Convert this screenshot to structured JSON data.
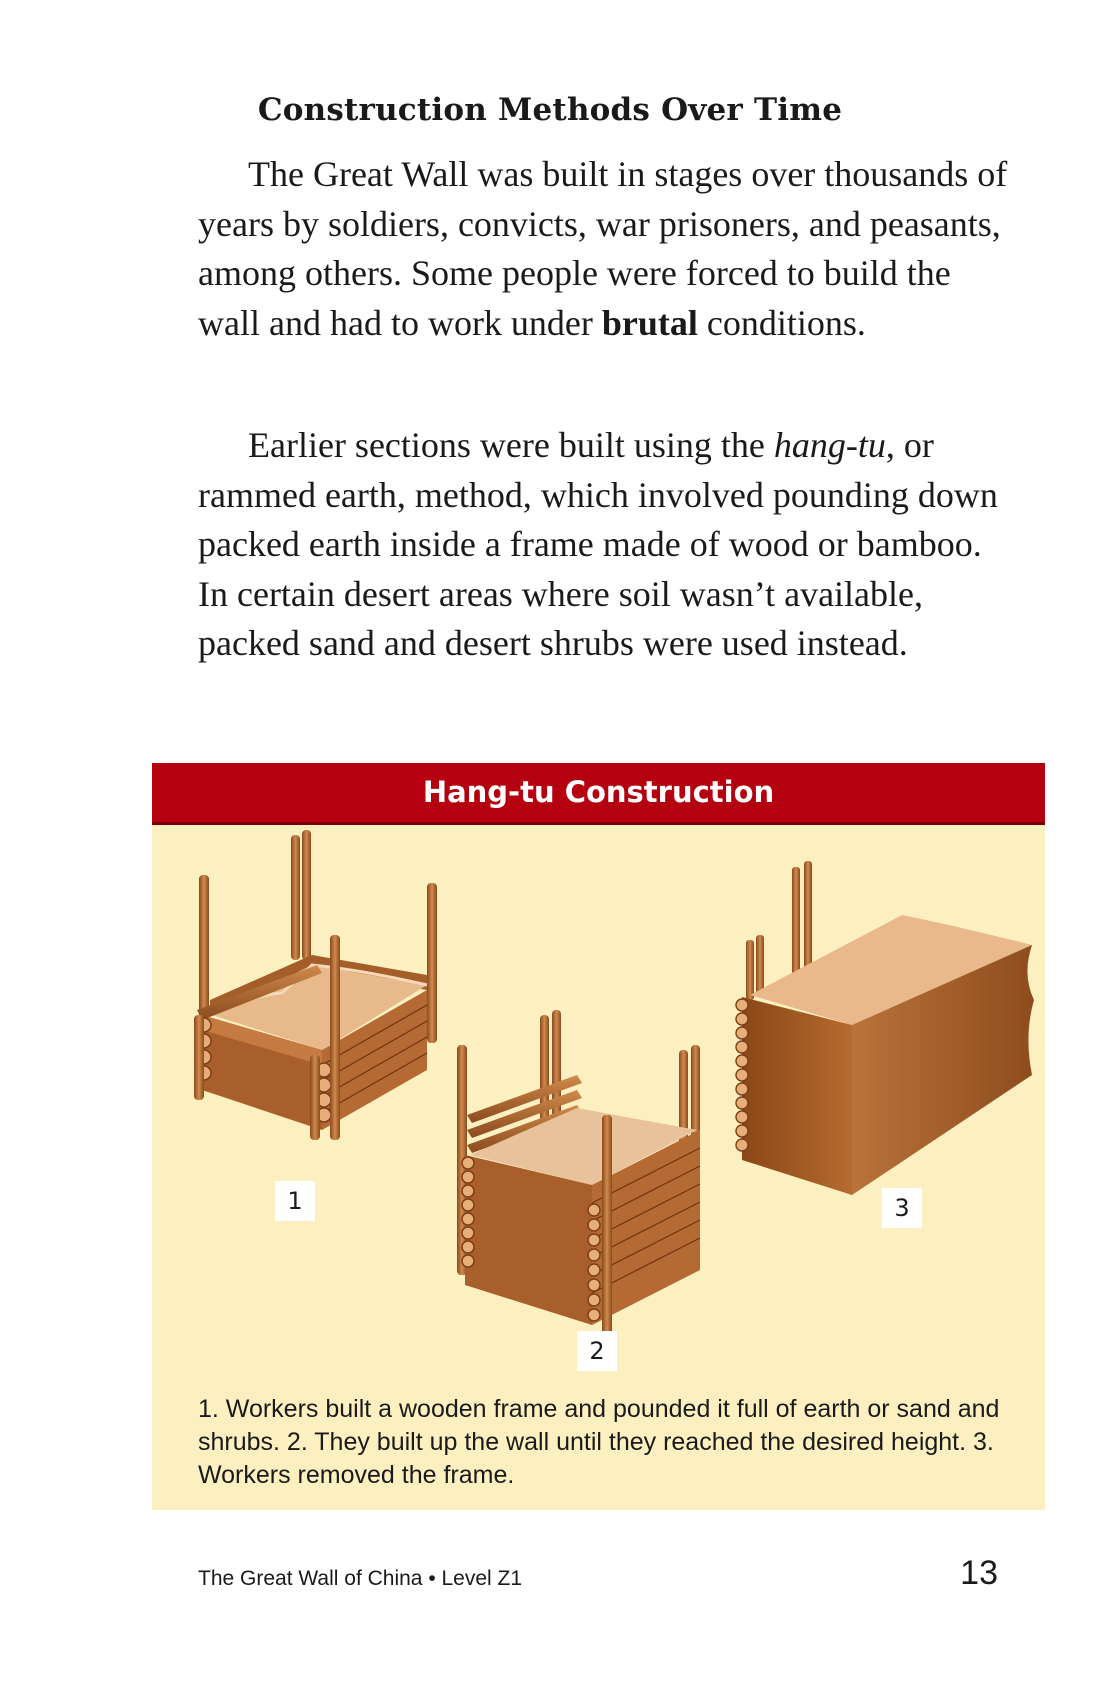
{
  "page": {
    "heading": "Construction Methods Over Time",
    "paragraph1": {
      "text_before_bold": "The Great Wall was built in stages over thousands of years by soldiers, convicts, war prisoners, and peasants, among others. Some people were forced to build the wall and had to work under ",
      "bold": "brutal",
      "text_after_bold": " conditions."
    },
    "paragraph2": {
      "text_before_italic": "Earlier sections were built using the ",
      "italic": "hang-tu",
      "text_after_italic": ", or rammed earth, method, which involved pounding down packed earth inside a frame made of wood or bamboo. In certain desert areas where soil wasn’t available, packed sand and desert shrubs were used instead."
    }
  },
  "figure": {
    "title": "Hang-tu Construction",
    "step_labels": [
      "1",
      "2",
      "3"
    ],
    "caption": "1. Workers built a wooden frame and pounded it full of earth or sand and shrubs. 2. They built up the wall until they reached the desired height. 3. Workers removed the frame.",
    "colors": {
      "title_bar": "#b5000f",
      "panel": "#fdf0c0",
      "wood": "#b86a32",
      "earth_top": "#e8b98a"
    }
  },
  "footer": {
    "book": "The Great Wall of China • Level Z1",
    "page_number": "13"
  }
}
